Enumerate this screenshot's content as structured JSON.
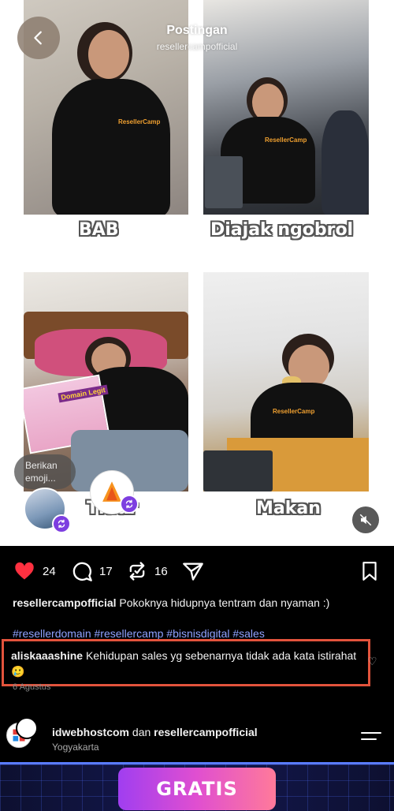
{
  "header": {
    "title": "Postingan",
    "subtitle": "resellercampofficial"
  },
  "collage": {
    "captions": [
      "BAB",
      "Diajak ngobrol",
      "Tidur",
      "Makan"
    ],
    "shirt_brand": "ResellerCamp",
    "poster_text": "Domain Legit"
  },
  "emoji_prompt": "Berikan emoji...",
  "actions": {
    "likes": "24",
    "comments": "17",
    "reposts": "16"
  },
  "caption": {
    "username": "resellercampofficial",
    "text": "Pokoknya hidupnya tentram dan nyaman :)",
    "hashtags": "#resellerdomain #resellercamp #bisnisdigital #sales"
  },
  "comment": {
    "username": "aliskaaashine",
    "text": "Kehidupan sales yg sebenarnya tidak ada kata istirahat🥲"
  },
  "date": "6 Agustus",
  "author": {
    "name1": "idwebhostcom",
    "connector": "dan",
    "name2": "resellercampofficial",
    "location": "Yogyakarta"
  },
  "banner": {
    "label": "GRATIS"
  },
  "colors": {
    "like_red": "#ff3040",
    "hashtag_blue": "#8fa2ff",
    "highlight_box": "#e2533c",
    "repost_purple": "#7d3ee0"
  }
}
